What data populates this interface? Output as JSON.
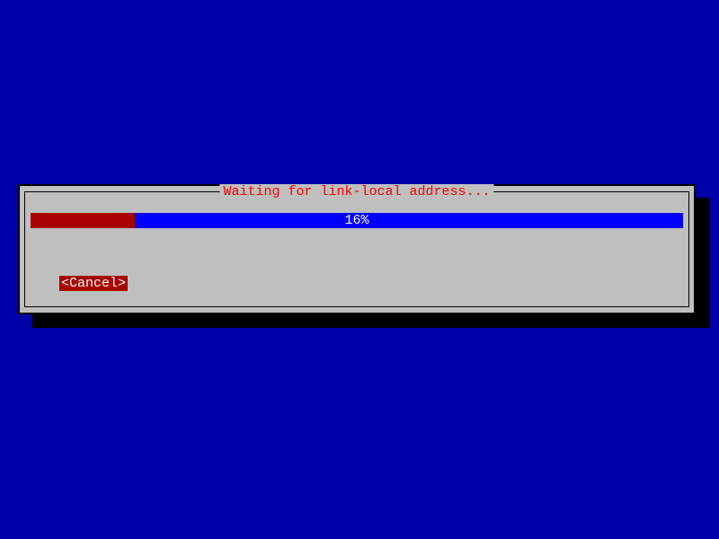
{
  "dialog": {
    "title": "Waiting for link-local address...",
    "progress_percent_label": "16%",
    "progress_percent_value": 16,
    "cancel_label": "<Cancel>"
  },
  "colors": {
    "background": "#0000a8",
    "dialog_bg": "#bfbfbf",
    "progress_bg": "#0000ff",
    "progress_fill": "#a80000",
    "button_bg": "#a80000",
    "title_color": "#ff0000"
  }
}
